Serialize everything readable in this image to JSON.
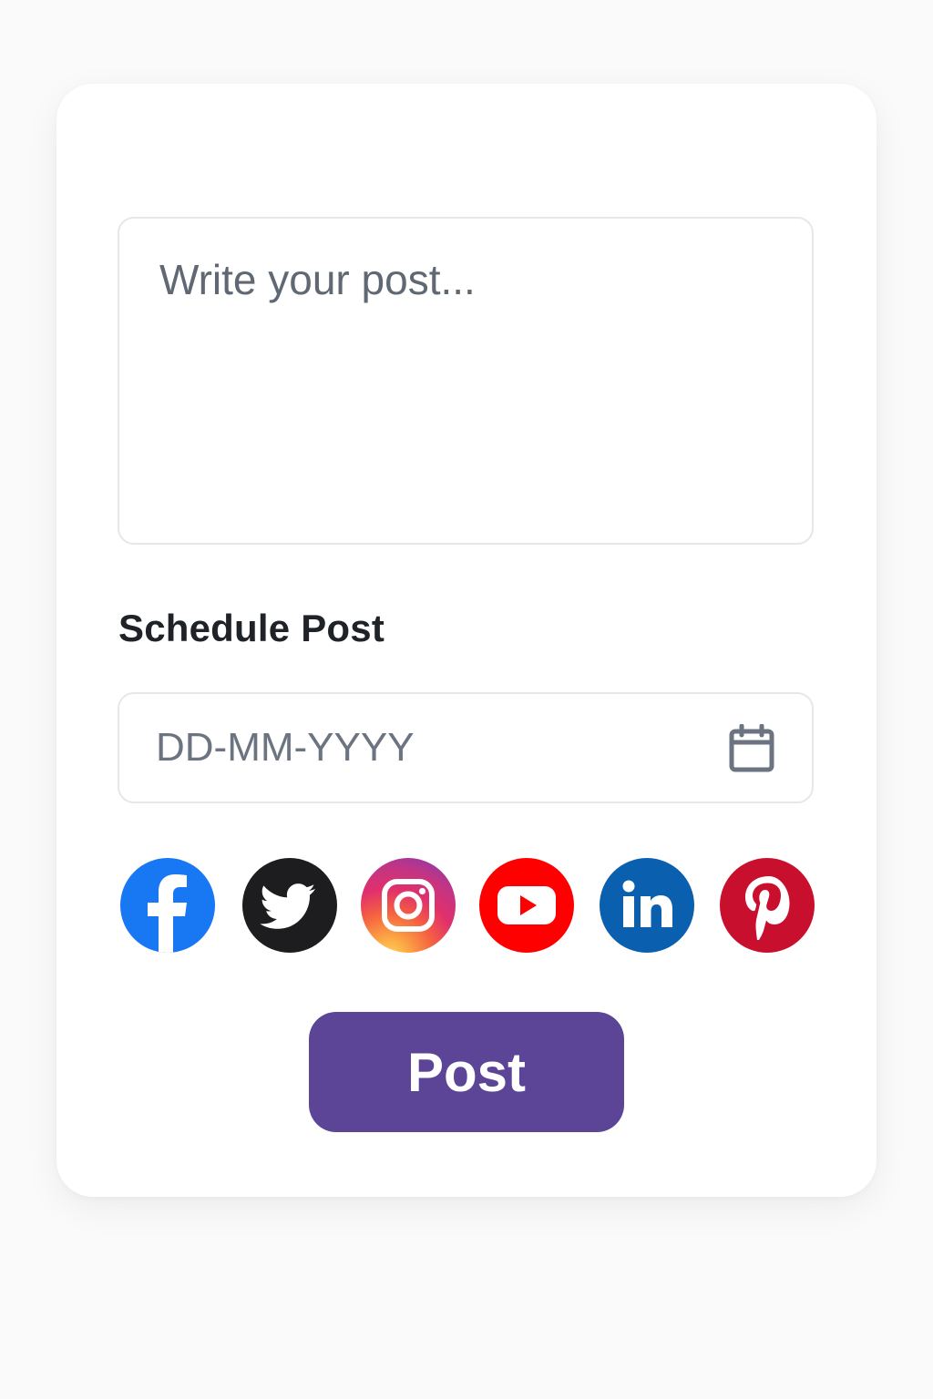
{
  "composer": {
    "placeholder": "Write your post..."
  },
  "schedule": {
    "label": "Schedule Post",
    "date_placeholder": "DD-MM-YYYY",
    "icon": "calendar-icon"
  },
  "social_networks": [
    {
      "name": "facebook-icon",
      "color": "#1877f2"
    },
    {
      "name": "twitter-icon",
      "color": "#1d1d1f"
    },
    {
      "name": "instagram-icon",
      "color": "#d6249f"
    },
    {
      "name": "youtube-icon",
      "color": "#ff0000"
    },
    {
      "name": "linkedin-icon",
      "color": "#0a66c2"
    },
    {
      "name": "pinterest-icon",
      "color": "#c8102e"
    }
  ],
  "actions": {
    "post_label": "Post",
    "post_color": "#5c4597"
  }
}
